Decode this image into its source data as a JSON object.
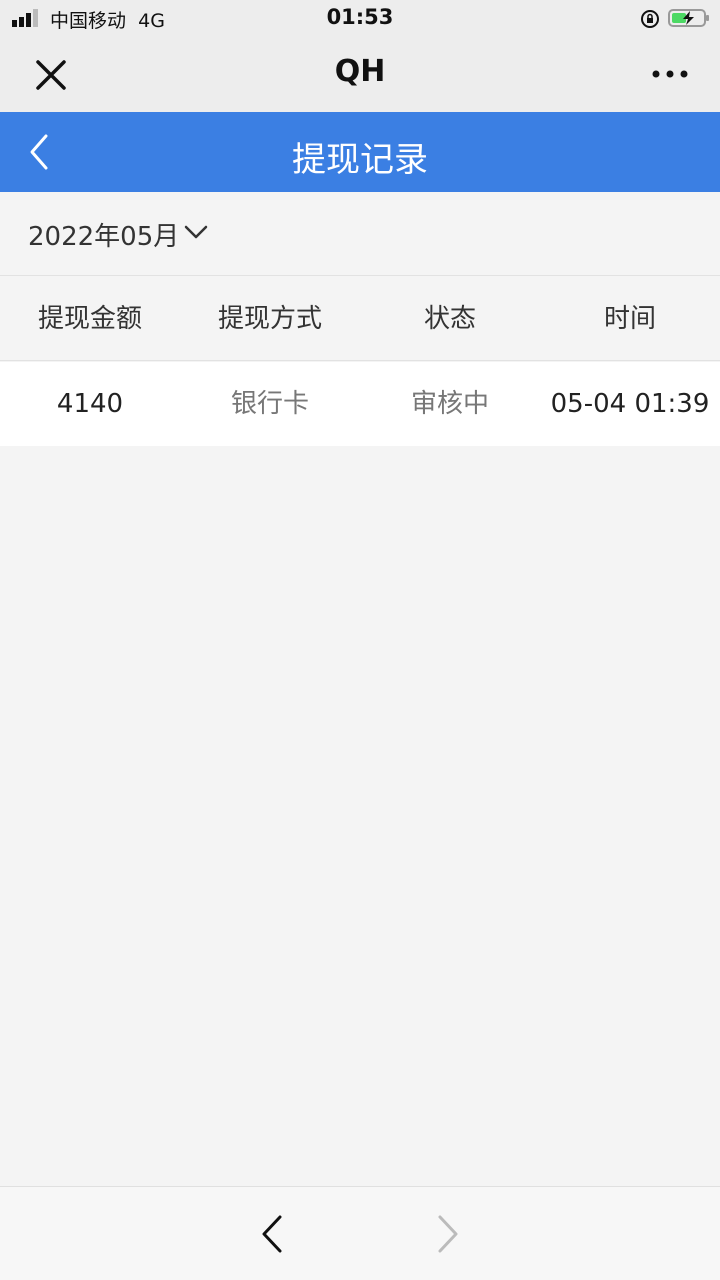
{
  "status_bar": {
    "carrier": "中国移动",
    "network": "4G",
    "time": "01:53"
  },
  "title_bar": {
    "title": "QH",
    "close_icon": "close-icon",
    "more_icon": "more-dots-icon"
  },
  "page_header": {
    "title": "提现记录",
    "back_icon": "chevron-left-icon",
    "background": "#3b7fe3"
  },
  "filter": {
    "month": "2022年05月",
    "dropdown_icon": "chevron-down-icon"
  },
  "table": {
    "headers": [
      "提现金额",
      "提现方式",
      "状态",
      "时间"
    ],
    "rows": [
      {
        "amount": "4140",
        "method": "银行卡",
        "status": "审核中",
        "time": "05-04 01:39"
      }
    ]
  },
  "bottom_nav": {
    "back_icon": "chevron-left-icon",
    "forward_icon": "chevron-right-icon"
  }
}
